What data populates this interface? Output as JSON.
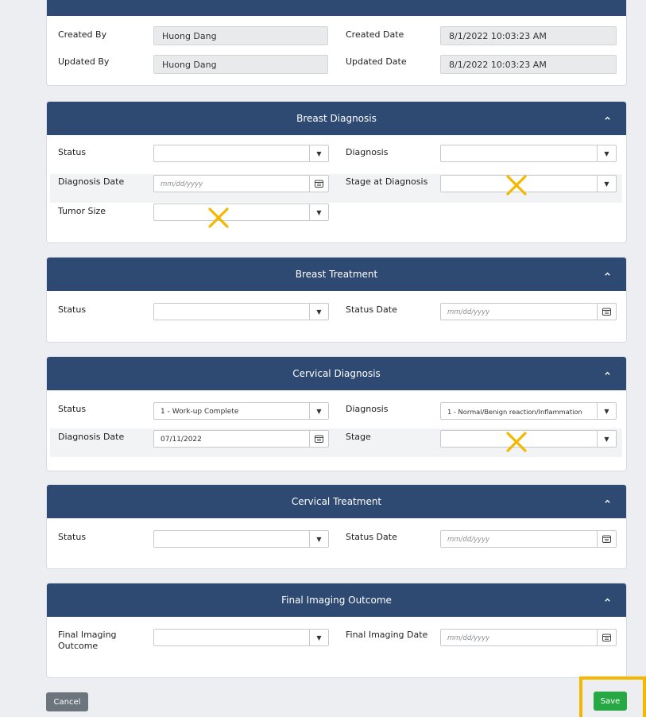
{
  "audit": {
    "created_by_label": "Created By",
    "created_by_value": "Huong Dang",
    "created_date_label": "Created Date",
    "created_date_value": "8/1/2022 10:03:23 AM",
    "updated_by_label": "Updated By",
    "updated_by_value": "Huong Dang",
    "updated_date_label": "Updated Date",
    "updated_date_value": "8/1/2022 10:03:23 AM"
  },
  "breast_diagnosis": {
    "title": "Breast Diagnosis",
    "status_label": "Status",
    "status_value": "",
    "diagnosis_label": "Diagnosis",
    "diagnosis_value": "",
    "diagnosis_date_label": "Diagnosis Date",
    "diagnosis_date_placeholder": "mm/dd/yyyy",
    "stage_label": "Stage at Diagnosis",
    "stage_value": "",
    "tumor_size_label": "Tumor Size",
    "tumor_size_value": ""
  },
  "breast_treatment": {
    "title": "Breast Treatment",
    "status_label": "Status",
    "status_value": "",
    "status_date_label": "Status Date",
    "status_date_placeholder": "mm/dd/yyyy"
  },
  "cervical_diagnosis": {
    "title": "Cervical Diagnosis",
    "status_label": "Status",
    "status_value": "1 - Work-up Complete",
    "diagnosis_label": "Diagnosis",
    "diagnosis_value": "1 - Normal/Benign reaction/Inflammation",
    "diagnosis_date_label": "Diagnosis Date",
    "diagnosis_date_value": "07/11/2022",
    "stage_label": "Stage",
    "stage_value": ""
  },
  "cervical_treatment": {
    "title": "Cervical Treatment",
    "status_label": "Status",
    "status_value": "",
    "status_date_label": "Status Date",
    "status_date_placeholder": "mm/dd/yyyy"
  },
  "final_imaging": {
    "title": "Final Imaging Outcome",
    "outcome_label_line1": "Final Imaging",
    "outcome_label_line2": "Outcome",
    "outcome_value": "",
    "date_label": "Final Imaging Date",
    "date_placeholder": "mm/dd/yyyy"
  },
  "actions": {
    "cancel_label": "Cancel",
    "save_label": "Save"
  },
  "icons": {
    "select": "caret-down-icon",
    "date": "calendar-icon",
    "collapse": "chevron-up-icon",
    "marker": "x-mark-icon"
  },
  "colors": {
    "header": "#2e4a73",
    "save": "#28a745",
    "cancel": "#6c757d",
    "highlight": "#f5b800"
  }
}
